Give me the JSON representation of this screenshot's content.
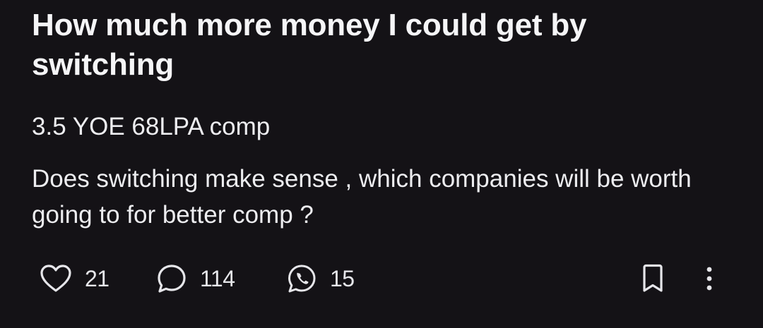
{
  "post": {
    "title": "How much more money I could get by switching",
    "subtitle": "3.5 YOE 68LPA comp",
    "body": "Does switching make sense , which companies will be worth going to for better comp ?"
  },
  "actions": {
    "likes": "21",
    "comments": "114",
    "shares": "15",
    "icons": {
      "like": "heart-icon",
      "comment": "comment-bubble-icon",
      "share": "whatsapp-icon",
      "bookmark": "bookmark-icon",
      "more": "more-vertical-icon"
    }
  },
  "colors": {
    "background": "#141216",
    "text": "#f2f2f4"
  }
}
